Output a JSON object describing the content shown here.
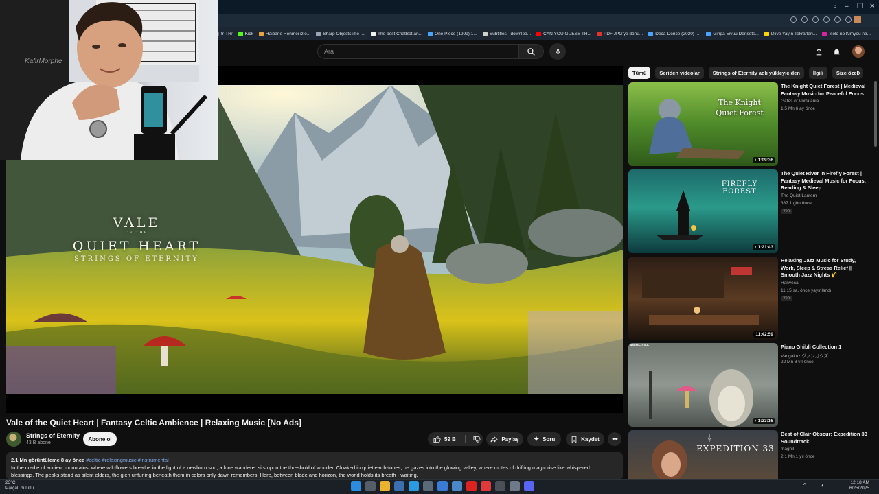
{
  "browser": {
    "bookmarks": [
      {
        "label": "tr-TR/",
        "color": "#5b6a7a"
      },
      {
        "label": "Kick",
        "color": "#53fc18"
      },
      {
        "label": "Haibane Renmei izle...",
        "color": "#e7a33e"
      },
      {
        "label": "Sharp Objects izle |...",
        "color": "#9aa6b5"
      },
      {
        "label": "The best ChatBot an...",
        "color": "#f2f2f2"
      },
      {
        "label": "One Piece (1999) 1...",
        "color": "#4aa3ff"
      },
      {
        "label": "Subtitles - downloa...",
        "color": "#cfcfcf"
      },
      {
        "label": "CAN YOU GUESS TH...",
        "color": "#ff0000"
      },
      {
        "label": "PDF JPG'ye dönü...",
        "color": "#e5322d"
      },
      {
        "label": "Deca-Dence (2020) -...",
        "color": "#4aa3ff"
      },
      {
        "label": "Ginga Eiyuu Densets...",
        "color": "#4aa3ff"
      },
      {
        "label": "Dlive Yayın Tekrarları...",
        "color": "#ffd300"
      },
      {
        "label": "Isolo no Kimyou na...",
        "color": "#d6249f"
      }
    ]
  },
  "masthead": {
    "search_placeholder": "Ara"
  },
  "video": {
    "overlay_title_line1": "VALE",
    "overlay_title_of": "OF THE",
    "overlay_title_line2": "QUIET HEART",
    "overlay_title_line3": "STRINGS OF ETERNITY",
    "title": "Vale of the Quiet Heart | Fantasy Celtic Ambience | Relaxing Music [No Ads]",
    "channel": "Strings of Eternity",
    "subscribers": "43 B abone",
    "subscribe_label": "Abone ol",
    "likes": "59 B",
    "share_label": "Paylaş",
    "ask_label": "Soru",
    "save_label": "Kaydet",
    "desc_stats": "2,1 Mn görüntüleme  8 ay önce",
    "desc_tags": "#celtic #relaxingmusic #instrumental",
    "desc_line1": "In the cradle of ancient mountains, where wildflowers breathe in the light of a newborn sun, a lone wanderer sits upon the threshold of wonder. Cloaked in quiet earth-tones, he gazes into the glowing valley, where motes of drifting magic rise like whispered",
    "desc_line2": "blessings. The peaks stand as silent elders, the glen unfurling beneath them in colors only dawn remembers. Here, between blade and horizon, the world holds its breath - waiting."
  },
  "chips": [
    "Tümü",
    "Seriden videolar",
    "Strings of Eternity adlı yükleyiciden",
    "İlgili",
    "Size özel"
  ],
  "recommendations": [
    {
      "title": "The Knight Quiet Forest | Medieval Fantasy Music for Peaceful Focus",
      "channel": "Gates of Vortalania",
      "meta": "1,5 Mn  6 ay önce",
      "duration": "1:09:36",
      "badge": "",
      "thumb_text": "The Knight\nQuiet Forest"
    },
    {
      "title": "The Quiet River in Firefly Forest | Fantasy Medieval Music for Focus, Reading & Sleep",
      "channel": "The Quiet Lantern",
      "meta": "387  1 gün önce",
      "duration": "1:21:43",
      "badge": "Yeni",
      "thumb_text": "FIREFLY FOREST"
    },
    {
      "title": "Relaxing Jazz Music for Study, Work, Sleep & Stress Relief || Smooth Jazz Nights 🎷",
      "channel": "Hanveca",
      "meta": "11  15 sa. önce yayınlandı",
      "duration": "11:42:59",
      "badge": "Yeni",
      "thumb_text": ""
    },
    {
      "title": "Piano Ghibli Collection 1",
      "channel": "Vangakuz ヴァンガクズ",
      "meta": "22 Mn  8 yıl önce",
      "duration": "1:33:16",
      "badge": "",
      "thumb_text": "ANIME LIFE"
    },
    {
      "title": "Best of Clair Obscur: Expedition 33 Soundtrack",
      "channel": "magnil",
      "meta": "2,1 Mn  1 yıl önce",
      "duration": "",
      "badge": "",
      "thumb_text": "EXPEDITION 33"
    }
  ],
  "taskbar": {
    "weather_temp": "23°C",
    "weather_desc": "Parçalı bulutlu",
    "time": "12:18 AM",
    "date": "6/25/2025"
  }
}
